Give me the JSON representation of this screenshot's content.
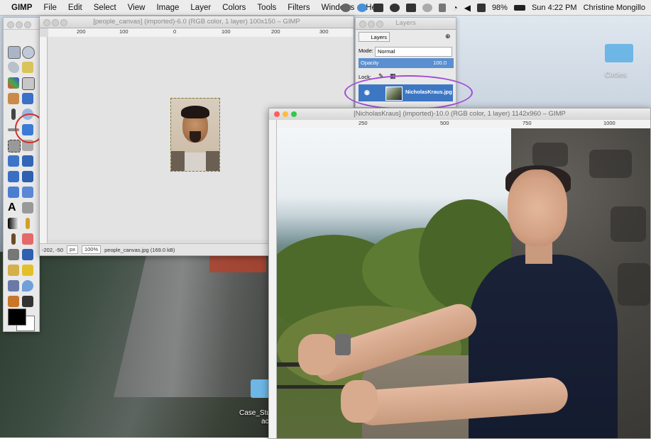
{
  "menubar": {
    "app": "GIMP",
    "items": [
      "File",
      "Edit",
      "Select",
      "View",
      "Image",
      "Layer",
      "Colors",
      "Tools",
      "Filters",
      "Windows",
      "Help"
    ],
    "battery": "98%",
    "clock": "Sun 4:22 PM",
    "user": "Christine Mongillo"
  },
  "canvas_window": {
    "title": "[people_canvas] (imported)-6.0 (RGB color, 1 layer) 100x150 – GIMP",
    "ruler_labels": [
      "200",
      "100",
      "0",
      "100",
      "200",
      "300"
    ],
    "status": {
      "coords": "-202, -50",
      "unit": "px",
      "zoom": "100%",
      "file": "people_canvas.jpg (169.0 kB)"
    }
  },
  "layers_panel": {
    "title": "Layers",
    "tab_label": "Layers",
    "mode_label": "Mode:",
    "mode_value": "Normal",
    "opacity_label": "Opacity",
    "opacity_value": "100.0",
    "lock_label": "Lock:",
    "layer_name": "NicholasKraus.jpg"
  },
  "photo_window": {
    "title": "[NicholasKraus] (imported)-10.0 (RGB color, 1 layer) 1142x960 – GIMP",
    "ruler_labels": [
      "250",
      "500",
      "750",
      "1000"
    ]
  },
  "desktop": {
    "folder_top_label": "Circles",
    "folder_bottom_label": "Case_Stud",
    "folder_bottom_label2": "ac"
  },
  "colors": {
    "highlight_ellipse": "#a34ad8",
    "highlight_circle": "#d1312a",
    "layer_selected": "#3d77c4",
    "move_tool": "#3b7bd6"
  },
  "toolbox": {
    "tools": [
      "rect-select",
      "ellipse-select",
      "free-select",
      "fuzzy-select",
      "select-by-color",
      "scissors",
      "foreground-select",
      "paths",
      "color-picker",
      "zoom",
      "measure",
      "move",
      "align",
      "crop",
      "rotate",
      "scale",
      "shear",
      "perspective",
      "flip",
      "cage",
      "text",
      "bucket-fill",
      "blend",
      "pencil",
      "paintbrush",
      "eraser",
      "airbrush",
      "ink",
      "clone",
      "heal",
      "perspective-clone",
      "blur",
      "smudge",
      "dodge"
    ]
  }
}
